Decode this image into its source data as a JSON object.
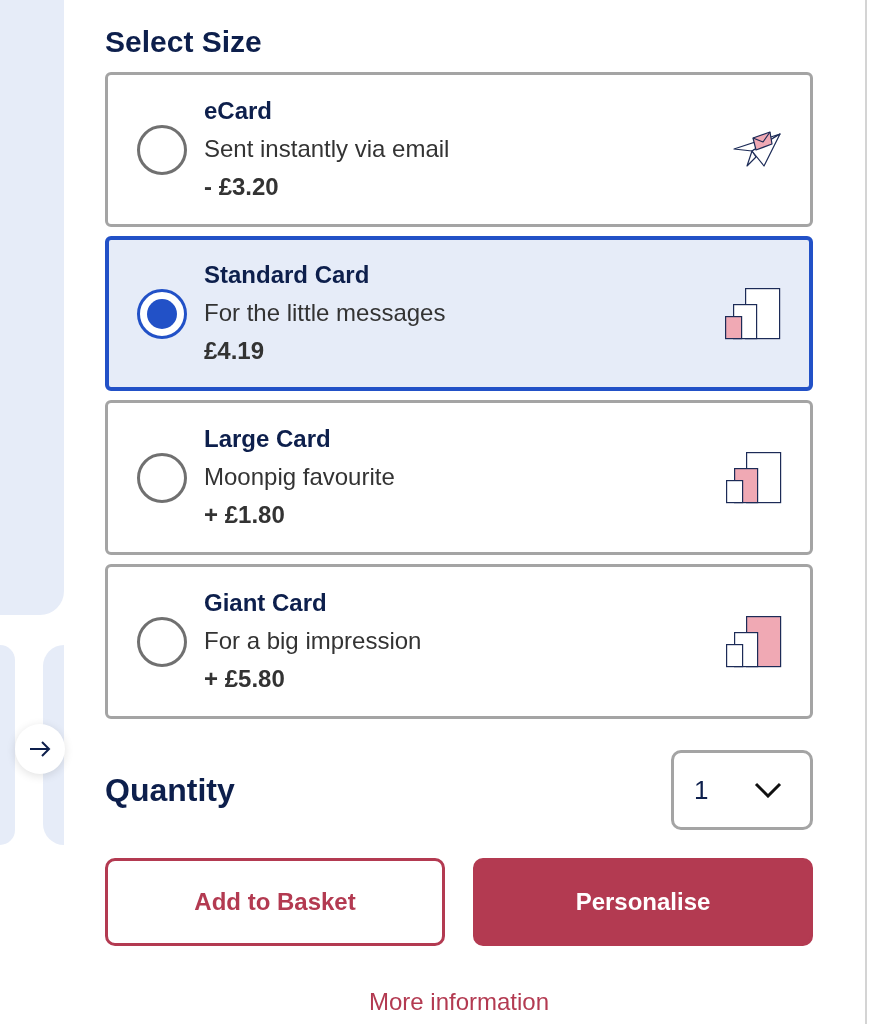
{
  "title": "Select Size",
  "options": [
    {
      "name": "eCard",
      "description": "Sent instantly via email",
      "price": "- £3.20",
      "selected": false,
      "kind": "ecard"
    },
    {
      "name": "Standard Card",
      "description": "For the little messages",
      "price": "£4.19",
      "selected": true,
      "kind": "standard"
    },
    {
      "name": "Large Card",
      "description": "Moonpig favourite",
      "price": "+ £1.80",
      "selected": false,
      "kind": "large"
    },
    {
      "name": "Giant Card",
      "description": "For a big impression",
      "price": "+ £5.80",
      "selected": false,
      "kind": "giant"
    }
  ],
  "quantity": {
    "label": "Quantity",
    "value": "1"
  },
  "buttons": [
    {
      "label": "Add to Basket",
      "kind": "outline"
    },
    {
      "label": "Personalise",
      "kind": "filled"
    }
  ],
  "link": "More information"
}
